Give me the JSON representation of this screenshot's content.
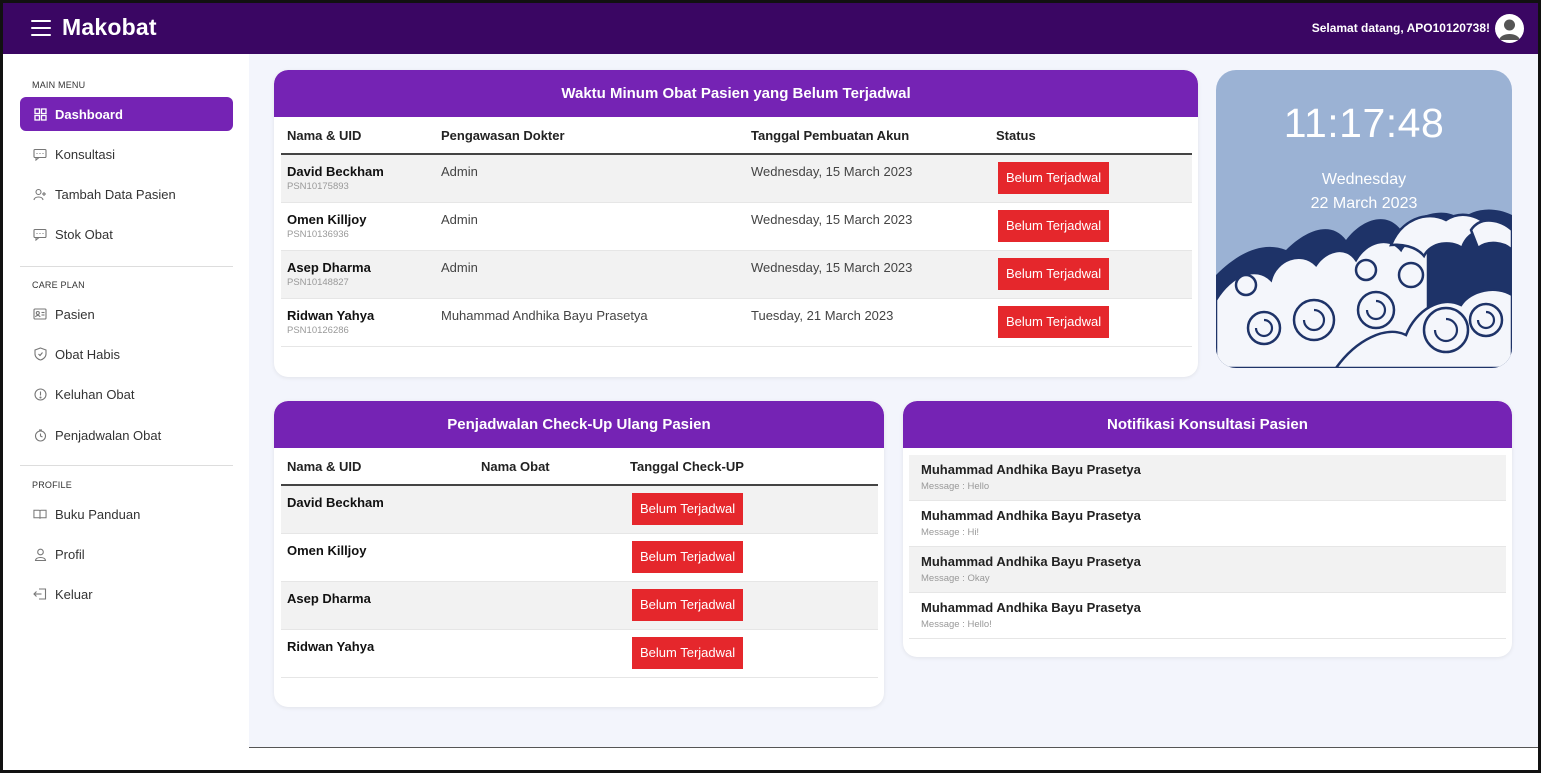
{
  "header": {
    "brand": "Makobat",
    "welcome": "Selamat datang, APO10120738!"
  },
  "sidebar": {
    "sections": [
      "MAIN MENU",
      "CARE PLAN",
      "PROFILE"
    ],
    "main_items": [
      {
        "label": "Dashboard",
        "icon": "dashboard-icon",
        "active": true
      },
      {
        "label": "Konsultasi",
        "icon": "chat-icon"
      },
      {
        "label": "Tambah Data Pasien",
        "icon": "add-user-icon"
      },
      {
        "label": "Stok Obat",
        "icon": "chat-icon"
      }
    ],
    "care_items": [
      {
        "label": "Pasien",
        "icon": "id-card-icon"
      },
      {
        "label": "Obat Habis",
        "icon": "shield-icon"
      },
      {
        "label": "Keluhan Obat",
        "icon": "info-icon"
      },
      {
        "label": "Penjadwalan Obat",
        "icon": "clock-icon"
      }
    ],
    "profile_items": [
      {
        "label": "Buku Panduan",
        "icon": "book-icon"
      },
      {
        "label": "Profil",
        "icon": "user-icon"
      },
      {
        "label": "Keluar",
        "icon": "logout-icon"
      }
    ]
  },
  "schedule_card": {
    "title": "Waktu Minum Obat Pasien yang Belum Terjadwal",
    "columns": [
      "Nama & UID",
      "Pengawasan Dokter",
      "Tanggal Pembuatan Akun",
      "Status"
    ],
    "rows": [
      {
        "name": "David Beckham",
        "uid": "PSN10175893",
        "doctor": "Admin",
        "created": "Wednesday, 15 March 2023",
        "status": "Belum Terjadwal"
      },
      {
        "name": "Omen Killjoy",
        "uid": "PSN10136936",
        "doctor": "Admin",
        "created": "Wednesday, 15 March 2023",
        "status": "Belum Terjadwal"
      },
      {
        "name": "Asep Dharma",
        "uid": "PSN10148827",
        "doctor": "Admin",
        "created": "Wednesday, 15 March 2023",
        "status": "Belum Terjadwal"
      },
      {
        "name": "Ridwan Yahya",
        "uid": "PSN10126286",
        "doctor": "Muhammad Andhika Bayu Prasetya",
        "created": "Tuesday, 21 March 2023",
        "status": "Belum Terjadwal"
      }
    ]
  },
  "clock": {
    "time": "11:17:48",
    "day": "Wednesday",
    "date": "22 March 2023"
  },
  "checkup_card": {
    "title": "Penjadwalan Check-Up Ulang Pasien",
    "columns": [
      "Nama & UID",
      "Nama Obat",
      "Tanggal Check-UP"
    ],
    "rows": [
      {
        "name": "David Beckham",
        "status": "Belum Terjadwal"
      },
      {
        "name": "Omen Killjoy",
        "status": "Belum Terjadwal"
      },
      {
        "name": "Asep Dharma",
        "status": "Belum Terjadwal"
      },
      {
        "name": "Ridwan Yahya",
        "status": "Belum Terjadwal"
      }
    ]
  },
  "notif_card": {
    "title": "Notifikasi Konsultasi Pasien",
    "items": [
      {
        "name": "Muhammad Andhika Bayu Prasetya",
        "message": "Message : Hello"
      },
      {
        "name": "Muhammad Andhika Bayu Prasetya",
        "message": "Message : Hi!"
      },
      {
        "name": "Muhammad Andhika Bayu Prasetya",
        "message": "Message : Okay"
      },
      {
        "name": "Muhammad Andhika Bayu Prasetya",
        "message": "Message : Hello!"
      }
    ]
  },
  "colors": {
    "topbar": "#3a0663",
    "accent": "#7523b4",
    "badge": "#e5272c",
    "clock_bg": "#9bb2d4"
  }
}
